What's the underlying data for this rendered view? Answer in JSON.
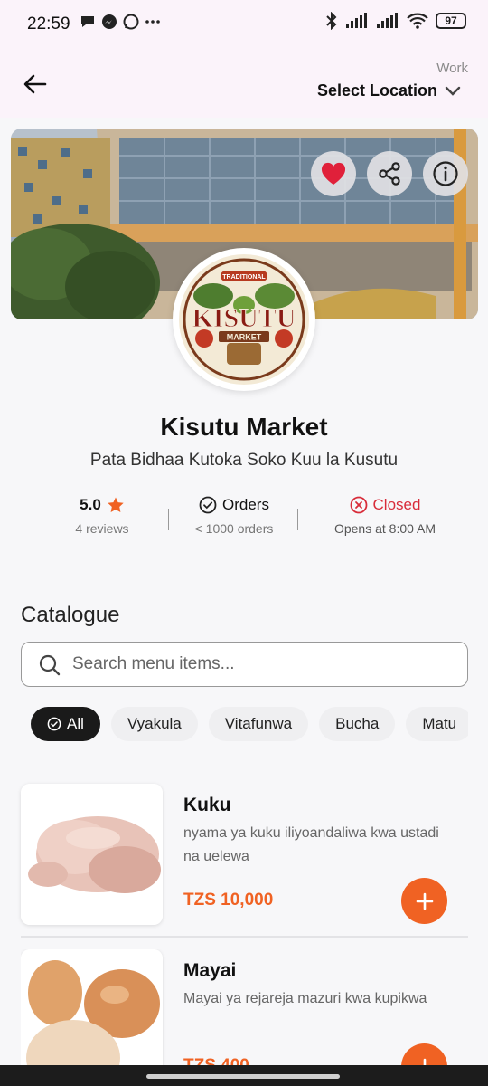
{
  "status_bar": {
    "time": "22:59",
    "battery": "97"
  },
  "header": {
    "location_label": "Work",
    "location_value": "Select Location"
  },
  "store": {
    "name": "Kisutu Market",
    "subtitle": "Pata Bidhaa Kutoka Soko Kuu la Kusutu",
    "logo_text": "KISUTU MARKET",
    "logo_top": "TRADITIONAL",
    "rating": "5.0",
    "reviews": "4 reviews",
    "orders_label": "Orders",
    "orders_sub": "< 1000 orders",
    "status": "Closed",
    "opens": "Opens at 8:00 AM"
  },
  "catalogue": {
    "title": "Catalogue",
    "search_placeholder": "Search menu items...",
    "chips": [
      "All",
      "Vyakula",
      "Vitafunwa",
      "Bucha",
      "Matu"
    ]
  },
  "products": [
    {
      "name": "Kuku",
      "description": "nyama ya kuku iliyoandaliwa kwa ustadi na uelewa",
      "price": "TZS 10,000"
    },
    {
      "name": "Mayai",
      "description": "Mayai ya rejareja mazuri kwa kupikwa",
      "price": "TZS 400"
    }
  ],
  "colors": {
    "accent": "#f06223",
    "closed": "#d82c3a",
    "star": "#f06223"
  }
}
